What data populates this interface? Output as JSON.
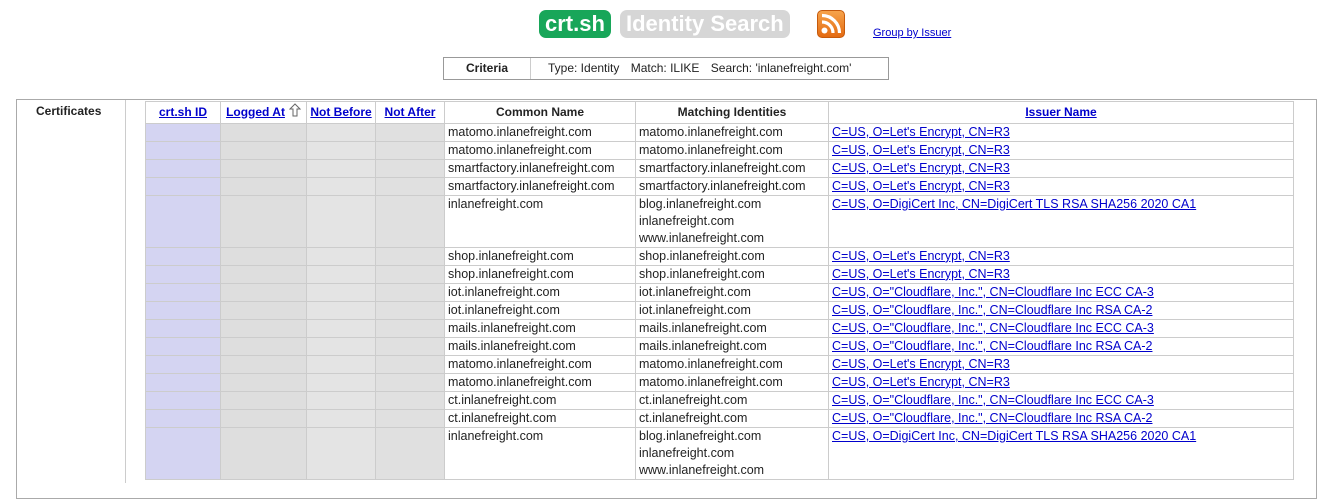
{
  "header": {
    "logo_text": "crt.sh",
    "title": "Identity Search",
    "rss_icon": "rss-feed-icon",
    "group_link": "Group by Issuer"
  },
  "criteria": {
    "label": "Criteria",
    "type": "Type: Identity",
    "match": "Match: ILIKE",
    "search": "Search: 'inlanefreight.com'"
  },
  "section_label": "Certificates",
  "columns": {
    "id": "crt.sh ID",
    "logged_at": "Logged At",
    "not_before": "Not Before",
    "not_after": "Not After",
    "common_name": "Common Name",
    "matching": "Matching Identities",
    "issuer": "Issuer Name"
  },
  "rows": [
    {
      "cn": "matomo.inlanefreight.com",
      "mi": [
        "matomo.inlanefreight.com"
      ],
      "issuer": "C=US, O=Let's Encrypt, CN=R3"
    },
    {
      "cn": "matomo.inlanefreight.com",
      "mi": [
        "matomo.inlanefreight.com"
      ],
      "issuer": "C=US, O=Let's Encrypt, CN=R3"
    },
    {
      "cn": "smartfactory.inlanefreight.com",
      "mi": [
        "smartfactory.inlanefreight.com"
      ],
      "issuer": "C=US, O=Let's Encrypt, CN=R3"
    },
    {
      "cn": "smartfactory.inlanefreight.com",
      "mi": [
        "smartfactory.inlanefreight.com"
      ],
      "issuer": "C=US, O=Let's Encrypt, CN=R3"
    },
    {
      "cn": "inlanefreight.com",
      "mi": [
        "blog.inlanefreight.com",
        "inlanefreight.com",
        "www.inlanefreight.com"
      ],
      "issuer": "C=US, O=DigiCert Inc, CN=DigiCert TLS RSA SHA256 2020 CA1"
    },
    {
      "cn": "shop.inlanefreight.com",
      "mi": [
        "shop.inlanefreight.com"
      ],
      "issuer": "C=US, O=Let's Encrypt, CN=R3"
    },
    {
      "cn": "shop.inlanefreight.com",
      "mi": [
        "shop.inlanefreight.com"
      ],
      "issuer": "C=US, O=Let's Encrypt, CN=R3"
    },
    {
      "cn": "iot.inlanefreight.com",
      "mi": [
        "iot.inlanefreight.com"
      ],
      "issuer": "C=US, O=\"Cloudflare, Inc.\", CN=Cloudflare Inc ECC CA-3"
    },
    {
      "cn": "iot.inlanefreight.com",
      "mi": [
        "iot.inlanefreight.com"
      ],
      "issuer": "C=US, O=\"Cloudflare, Inc.\", CN=Cloudflare Inc RSA CA-2"
    },
    {
      "cn": "mails.inlanefreight.com",
      "mi": [
        "mails.inlanefreight.com"
      ],
      "issuer": "C=US, O=\"Cloudflare, Inc.\", CN=Cloudflare Inc ECC CA-3"
    },
    {
      "cn": "mails.inlanefreight.com",
      "mi": [
        "mails.inlanefreight.com"
      ],
      "issuer": "C=US, O=\"Cloudflare, Inc.\", CN=Cloudflare Inc RSA CA-2"
    },
    {
      "cn": "matomo.inlanefreight.com",
      "mi": [
        "matomo.inlanefreight.com"
      ],
      "issuer": "C=US, O=Let's Encrypt, CN=R3"
    },
    {
      "cn": "matomo.inlanefreight.com",
      "mi": [
        "matomo.inlanefreight.com"
      ],
      "issuer": "C=US, O=Let's Encrypt, CN=R3"
    },
    {
      "cn": "ct.inlanefreight.com",
      "mi": [
        "ct.inlanefreight.com"
      ],
      "issuer": "C=US, O=\"Cloudflare, Inc.\", CN=Cloudflare Inc ECC CA-3"
    },
    {
      "cn": "ct.inlanefreight.com",
      "mi": [
        "ct.inlanefreight.com"
      ],
      "issuer": "C=US, O=\"Cloudflare, Inc.\", CN=Cloudflare Inc RSA CA-2"
    },
    {
      "cn": "inlanefreight.com",
      "mi": [
        "blog.inlanefreight.com",
        "inlanefreight.com",
        "www.inlanefreight.com"
      ],
      "issuer": "C=US, O=DigiCert Inc, CN=DigiCert TLS RSA SHA256 2020 CA1"
    }
  ]
}
